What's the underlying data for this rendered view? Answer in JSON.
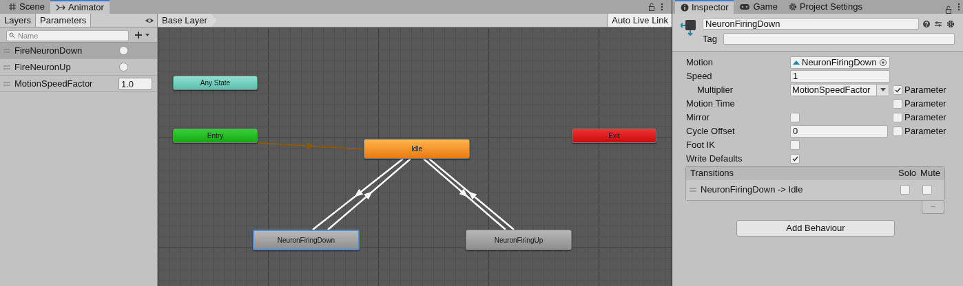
{
  "left_tabs": [
    {
      "label": "Scene",
      "selected": false
    },
    {
      "label": "Animator",
      "selected": true
    }
  ],
  "right_tabs": [
    {
      "label": "Inspector",
      "selected": true
    },
    {
      "label": "Game",
      "selected": false
    },
    {
      "label": "Project Settings",
      "selected": false
    }
  ],
  "animator": {
    "subtabs": [
      {
        "label": "Layers",
        "selected": false
      },
      {
        "label": "Parameters",
        "selected": true
      }
    ],
    "search": {
      "placeholder": "Name"
    },
    "parameters": [
      {
        "name": "FireNeuronDown",
        "kind": "trigger",
        "selected": true
      },
      {
        "name": "FireNeuronUp",
        "kind": "trigger",
        "selected": false
      },
      {
        "name": "MotionSpeedFactor",
        "kind": "float",
        "value": "1.0",
        "selected": false
      }
    ],
    "breadcrumb": "Base Layer",
    "live_link": "Auto Live Link",
    "states": [
      {
        "name": "Any State",
        "kind": "any",
        "selected": false
      },
      {
        "name": "Entry",
        "kind": "entry",
        "selected": false
      },
      {
        "name": "Idle",
        "kind": "default",
        "selected": false
      },
      {
        "name": "Exit",
        "kind": "exit",
        "selected": false
      },
      {
        "name": "NeuronFiringDown",
        "kind": "state",
        "selected": true
      },
      {
        "name": "NeuronFiringUp",
        "kind": "state",
        "selected": false
      }
    ]
  },
  "inspector": {
    "name": "NeuronFiringDown",
    "tag_label": "Tag",
    "fields": [
      {
        "label": "Motion",
        "kind": "object",
        "value": "NeuronFiringDown"
      },
      {
        "label": "Speed",
        "kind": "text",
        "value": "1"
      },
      {
        "label": "Multiplier",
        "kind": "dropdown",
        "value": "MotionSpeedFactor",
        "indented": true,
        "parameter": {
          "label": "Parameter",
          "checked": true
        }
      },
      {
        "label": "Motion Time",
        "kind": "none",
        "parameter": {
          "label": "Parameter",
          "checked": false
        }
      },
      {
        "label": "Mirror",
        "kind": "checkbox",
        "checked": false,
        "parameter": {
          "label": "Parameter",
          "checked": false
        }
      },
      {
        "label": "Cycle Offset",
        "kind": "short_text",
        "value": "0",
        "parameter": {
          "label": "Parameter",
          "checked": false
        }
      },
      {
        "label": "Foot IK",
        "kind": "checkbox",
        "checked": false
      },
      {
        "label": "Write Defaults",
        "kind": "checkbox",
        "checked": true
      }
    ],
    "transitions": {
      "title": "Transitions",
      "solo": "Solo",
      "mute": "Mute",
      "rows": [
        {
          "label": "NeuronFiringDown -> Idle",
          "solo": false,
          "mute": false
        }
      ],
      "remove": "−"
    },
    "add_button": "Add Behaviour"
  }
}
